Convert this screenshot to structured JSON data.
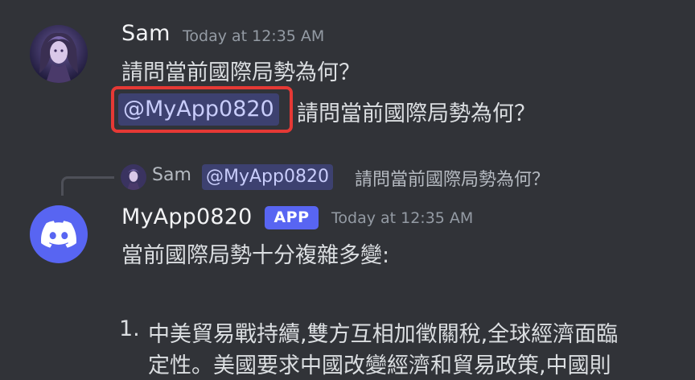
{
  "message1": {
    "username": "Sam",
    "timestamp": "Today at 12:35 AM",
    "line1": "請問當前國際局勢為何？",
    "mention": "@MyApp0820",
    "line2_text": "請問當前國際局勢為何？"
  },
  "reply": {
    "username": "Sam",
    "mention": "@MyApp0820",
    "text": "請問當前國際局勢為何？"
  },
  "message2": {
    "username": "MyApp0820",
    "badge": "APP",
    "timestamp": "Today at 12:35 AM",
    "intro": "當前國際局勢十分複雜多變:",
    "item1_number": "1.",
    "item1_line1": "中美貿易戰持續,雙方互相加徵關稅,全球經濟面臨",
    "item1_line2": "定性。美國要求中國改變經濟和貿易政策,中國則"
  },
  "colors": {
    "background": "#313338",
    "accent": "#5865f2",
    "highlight_border": "#e53935"
  }
}
